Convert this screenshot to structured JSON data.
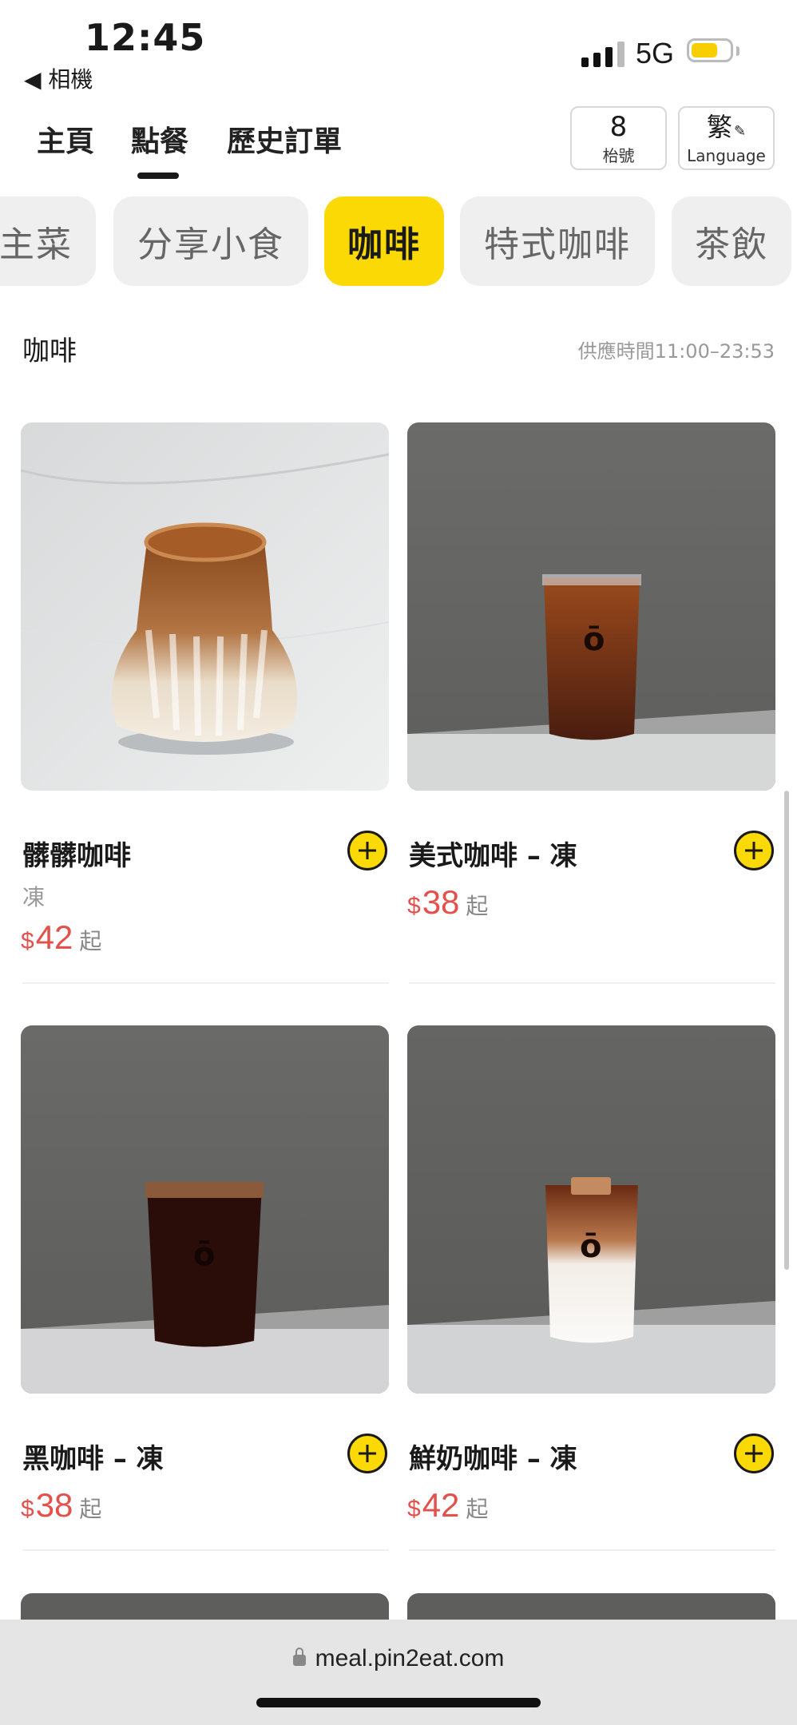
{
  "status_bar": {
    "time": "12:45",
    "back_app": "◀ 相機",
    "network": "5G"
  },
  "nav": {
    "tabs": [
      "主頁",
      "點餐",
      "歷史訂單"
    ],
    "active_tab": "點餐",
    "table": {
      "number": "8",
      "label": "枱號"
    },
    "language": {
      "main": "繁",
      "sub": "Language",
      "icon": "pencil-icon"
    }
  },
  "categories": [
    "主菜",
    "分享小食",
    "咖啡",
    "特式咖啡",
    "茶飲"
  ],
  "active_category": "咖啡",
  "section": {
    "title": "咖啡",
    "hours": "供應時間11:00–23:53"
  },
  "products": [
    {
      "name": "髒髒咖啡",
      "sub": "凍",
      "currency": "$",
      "price": "42",
      "suffix": "起"
    },
    {
      "name": "美式咖啡 – 凍",
      "sub": "",
      "currency": "$",
      "price": "38",
      "suffix": "起"
    },
    {
      "name": "黑咖啡 – 凍",
      "sub": "",
      "currency": "$",
      "price": "38",
      "suffix": "起"
    },
    {
      "name": "鮮奶咖啡 – 凍",
      "sub": "",
      "currency": "$",
      "price": "42",
      "suffix": "起"
    }
  ],
  "browser": {
    "url": "meal.pin2eat.com"
  },
  "colors": {
    "accent": "#fbd905",
    "price": "#e3514d",
    "chip_bg": "#efefef"
  }
}
